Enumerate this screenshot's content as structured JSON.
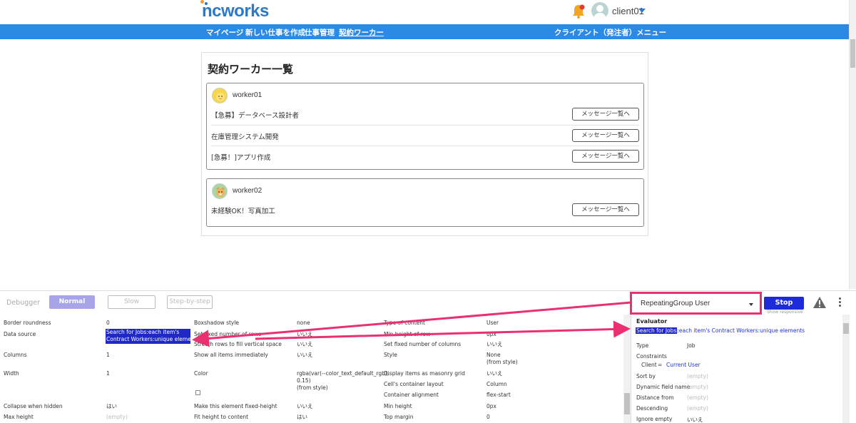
{
  "header": {
    "logo": "ncworks",
    "user_name": "client01"
  },
  "nav": {
    "items": [
      {
        "label": "マイページ"
      },
      {
        "label": "新しい仕事を作成"
      },
      {
        "label": "仕事管理"
      },
      {
        "label": "契約ワーカー"
      }
    ],
    "right_menu": "クライアント（発注者）メニュー"
  },
  "page": {
    "title": "契約ワーカー一覧",
    "workers": [
      {
        "name": "worker01",
        "jobs": [
          {
            "title": "【急募】データベース設計者",
            "button": "メッセージ一覧へ"
          },
          {
            "title": "在庫管理システム開発",
            "button": "メッセージ一覧へ"
          },
          {
            "title": "[急募！]アプリ作成",
            "button": "メッセージ一覧へ"
          }
        ]
      },
      {
        "name": "worker02",
        "jobs": [
          {
            "title": "未経験OK！写真加工",
            "button": "メッセージ一覧へ"
          }
        ]
      }
    ]
  },
  "debugger": {
    "label": "Debugger",
    "modes": {
      "normal": "Normal",
      "slow": "Slow",
      "step": "Step-by-step"
    },
    "inspect_selected": "RepeatingGroup User",
    "stop": "Stop",
    "show_responsive": "Show responsive",
    "props": {
      "col1": [
        {
          "label": "Border roundness",
          "value": "0"
        },
        {
          "label": "Data source",
          "value": "Search for Jobs:each item's\nContract Workers:unique elements"
        },
        {
          "label": "Columns",
          "value": "1"
        },
        {
          "label": "Width",
          "value": "1"
        },
        {
          "label": "Collapse when hidden",
          "value": "はい"
        },
        {
          "label": "Max height",
          "value": "(empty)"
        }
      ],
      "col2": [
        {
          "label": "Boxshadow style",
          "value": "none"
        },
        {
          "label": "Set fixed number of rows",
          "value": "いいえ"
        },
        {
          "label": "Stretch rows to fill vertical space",
          "value": "いいえ"
        },
        {
          "label": "Show all items immediately",
          "value": "いいえ"
        },
        {
          "label": "Color",
          "value": "rgba(var(--color_text_default_rgb),\n0.15)\n(from style)"
        },
        {
          "label": "Make this element fixed-height",
          "value": "いいえ"
        },
        {
          "label": "Fit height to content",
          "value": "はい"
        }
      ],
      "col3": [
        {
          "label": "Type of content",
          "value": "User"
        },
        {
          "label": "Min height of row",
          "value": "0px"
        },
        {
          "label": "Set fixed number of columns",
          "value": "いいえ"
        },
        {
          "label": "Style",
          "value": "None\n(from style)"
        },
        {
          "label": "Display items as masonry grid",
          "value": "いいえ"
        },
        {
          "label": "Cell's container layout",
          "value": "Column"
        },
        {
          "label": "Container alignment",
          "value": "flex-start"
        },
        {
          "label": "Min height",
          "value": "0px"
        },
        {
          "label": "Top margin",
          "value": "0"
        }
      ]
    },
    "evaluator": {
      "title": "Evaluator",
      "expr_highlight": "Search for Jobs",
      "expr_rest": ":each item's Contract Workers:unique elements",
      "type_label": "Type",
      "type_value": "Job",
      "constraints_label": "Constraints",
      "constraint_field": "Client",
      "constraint_op": "=",
      "constraint_value": "Current User",
      "rows": [
        {
          "label": "Sort by",
          "value": "(empty)"
        },
        {
          "label": "Dynamic field name",
          "value": "(empty)"
        },
        {
          "label": "Distance from",
          "value": "(empty)"
        },
        {
          "label": "Descending",
          "value": "(empty)"
        },
        {
          "label": "Ignore empty",
          "value": "いいえ"
        }
      ]
    }
  },
  "colors": {
    "nav_bg": "#2d89e3",
    "logo": "#2c79c9",
    "annotation": "#ea2f73",
    "stop": "#1d2bdb",
    "normal_btn": "#a7a4e8"
  }
}
